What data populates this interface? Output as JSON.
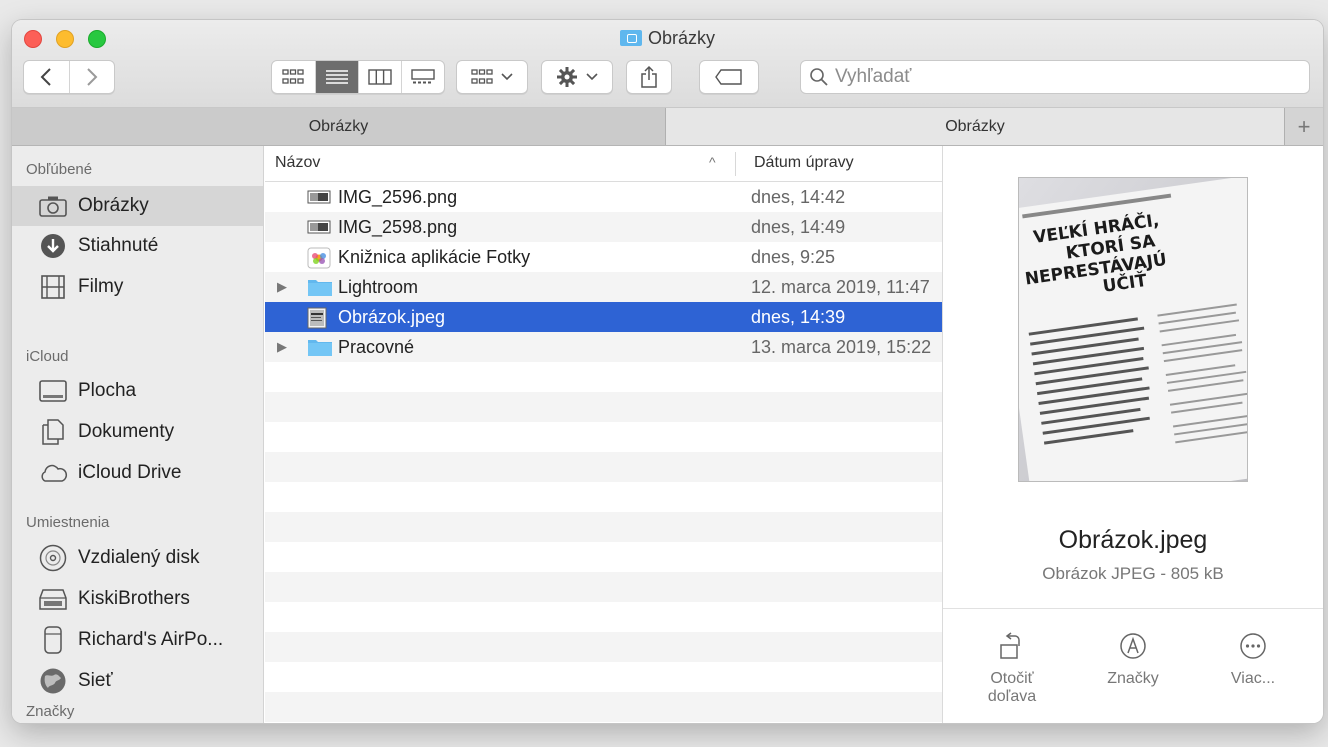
{
  "window": {
    "title": "Obrázky"
  },
  "toolbar": {
    "search_placeholder": "Vyhľadať"
  },
  "tabs": [
    {
      "label": "Obrázky",
      "active": false
    },
    {
      "label": "Obrázky",
      "active": true
    }
  ],
  "sidebar": {
    "sections": {
      "favorites": "Obľúbené",
      "icloud": "iCloud",
      "locations": "Umiestnenia",
      "tags": "Značky"
    },
    "items": {
      "pictures": "Obrázky",
      "downloads": "Stiahnuté",
      "movies": "Filmy",
      "desktop": "Plocha",
      "documents": "Dokumenty",
      "icloud_drive": "iCloud Drive",
      "remote_disc": "Vzdialený disk",
      "kiski": "KiskiBrothers",
      "airpods": "Richard's AirPo...",
      "network": "Sieť"
    }
  },
  "list": {
    "columns": {
      "name": "Názov",
      "date": "Dátum úpravy"
    },
    "rows": [
      {
        "name": "IMG_2596.png",
        "date": "dnes, 14:42",
        "kind": "png",
        "folder": false,
        "selected": false
      },
      {
        "name": "IMG_2598.png",
        "date": "dnes, 14:49",
        "kind": "png",
        "folder": false,
        "selected": false
      },
      {
        "name": "Knižnica aplikácie Fotky",
        "date": "dnes, 9:25",
        "kind": "photos-library",
        "folder": false,
        "selected": false
      },
      {
        "name": "Lightroom",
        "date": "12. marca 2019, 11:47",
        "kind": "folder",
        "folder": true,
        "selected": false
      },
      {
        "name": "Obrázok.jpeg",
        "date": "dnes, 14:39",
        "kind": "jpeg",
        "folder": false,
        "selected": true
      },
      {
        "name": "Pracovné",
        "date": "13. marca 2019, 15:22",
        "kind": "folder",
        "folder": true,
        "selected": false
      }
    ]
  },
  "preview": {
    "filename": "Obrázok.jpeg",
    "meta": "Obrázok JPEG - 805 kB",
    "thumbnail_text": {
      "line1": "VEĽKÍ HRÁČI,",
      "line2": "KTORÍ SA",
      "line3": "NEPRESTÁVAJÚ",
      "line4": "UČIŤ"
    },
    "actions": {
      "rotate_line1": "Otočiť",
      "rotate_line2": "doľava",
      "markup": "Značky",
      "more": "Viac..."
    }
  },
  "colors": {
    "selection": "#2e63d4",
    "folder": "#5fb7ee",
    "close": "#fc5f57",
    "minimize": "#fdbc2e",
    "zoom": "#28c840"
  }
}
